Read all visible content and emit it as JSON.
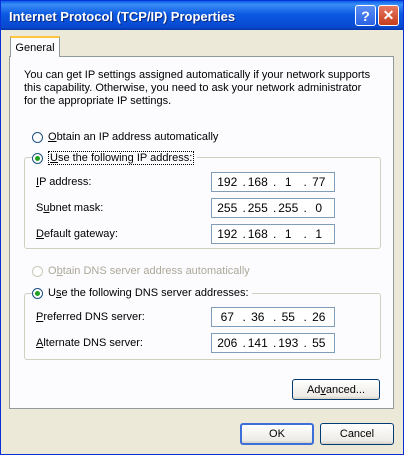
{
  "window": {
    "title": "Internet Protocol (TCP/IP) Properties",
    "help_label": "?",
    "close_label": "✕"
  },
  "tabs": [
    {
      "label": "General"
    }
  ],
  "intro_text": "You can get IP settings assigned automatically if your network supports this capability. Otherwise, you need to ask your network administrator for the appropriate IP settings.",
  "ip_mode": {
    "auto": {
      "prefix": "O",
      "rest": "btain an IP address automatically",
      "selected": false
    },
    "manual": {
      "prefix": "U",
      "rest": "se the following IP address:",
      "selected": true
    }
  },
  "ip_fields": {
    "ip_address": {
      "prefix": "I",
      "rest": "P address:",
      "octets": [
        "192",
        "168",
        "1",
        "77"
      ]
    },
    "subnet_mask": {
      "prefix": "S",
      "mid": "u",
      "rest": "bnet mask:",
      "octets": [
        "255",
        "255",
        "255",
        "0"
      ]
    },
    "default_gateway": {
      "prefix": "D",
      "rest": "efault gateway:",
      "octets": [
        "192",
        "168",
        "1",
        "1"
      ]
    }
  },
  "dns_mode": {
    "auto": {
      "prefix": "O",
      "mid": "b",
      "rest": "tain DNS server address automatically",
      "selected": false,
      "disabled": true
    },
    "manual": {
      "prefix": "U",
      "mid": "s",
      "rest": "e the following DNS server addresses:",
      "selected": true
    }
  },
  "dns_fields": {
    "preferred": {
      "prefix": "P",
      "rest": "referred DNS server:",
      "octets": [
        "67",
        "36",
        "55",
        "26"
      ]
    },
    "alternate": {
      "prefix": "A",
      "rest": "lternate DNS server:",
      "octets": [
        "206",
        "141",
        "193",
        "55"
      ]
    }
  },
  "buttons": {
    "advanced": {
      "pre": "Ad",
      "u": "v",
      "post": "anced..."
    },
    "ok": "OK",
    "cancel": "Cancel"
  },
  "separator": "."
}
